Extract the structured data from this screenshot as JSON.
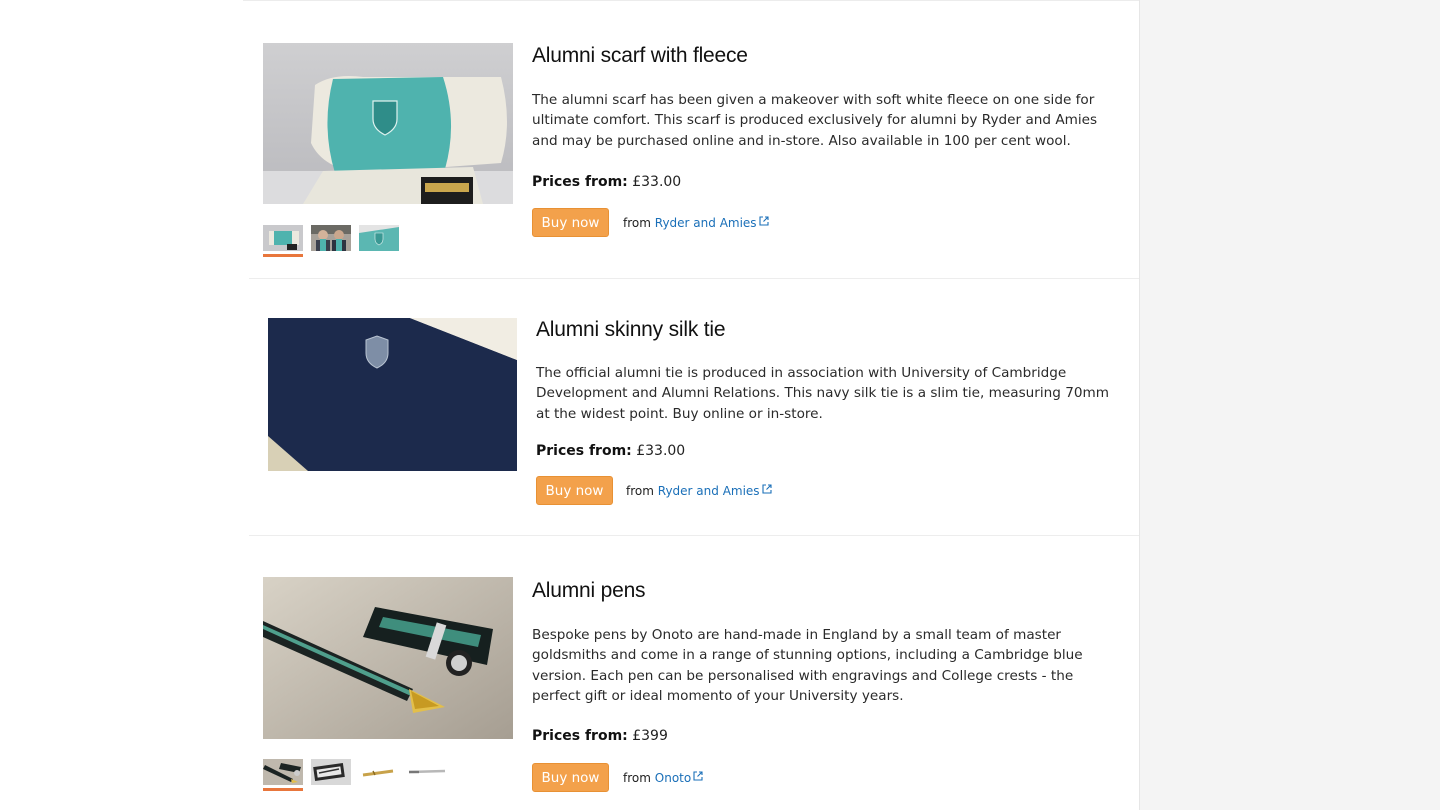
{
  "products": [
    {
      "title": "Alumni scarf with fleece",
      "description": "The alumni scarf has been given a makeover with soft white fleece on one side for ultimate comfort. This scarf is produced exclusively for alumni by Ryder and Amies and may be purchased online and in-store. Also available in 100 per cent wool.",
      "price_label": "Prices from:",
      "price_value": "£33.00",
      "buy_label": "Buy now",
      "from_text": "from",
      "vendor": "Ryder and Amies",
      "thumbnails": [
        "scarf-folded",
        "alumni-wearing-scarf",
        "scarf-crest-closeup"
      ]
    },
    {
      "title": "Alumni skinny silk tie",
      "description": "The official alumni tie is produced in association with University of Cambridge Development and Alumni Relations. This navy silk tie is a slim tie, measuring 70mm at the widest point. Buy online or in-store.",
      "price_label": "Prices from:",
      "price_value": "£33.00",
      "buy_label": "Buy now",
      "from_text": "from",
      "vendor": "Ryder and Amies"
    },
    {
      "title": "Alumni pens",
      "description": "Bespoke pens by Onoto are hand-made in England by a small team of master goldsmiths and come in a range of stunning options, including a Cambridge blue version. Each pen can be personalised with engravings and College crests - the perfect gift or ideal momento of your University years.",
      "price_label": "Prices from:",
      "price_value": "£399",
      "buy_label": "Buy now",
      "from_text": "from",
      "vendor": "Onoto",
      "thumbnails": [
        "pen-uncapped",
        "pen-gift-box",
        "gold-pen-nib",
        "silver-pen"
      ]
    }
  ],
  "colors": {
    "buy_button": "#f3a14b",
    "link": "#1a6fb8",
    "active_thumb_border": "#e8763c",
    "side_panel": "#f4f4f4"
  }
}
